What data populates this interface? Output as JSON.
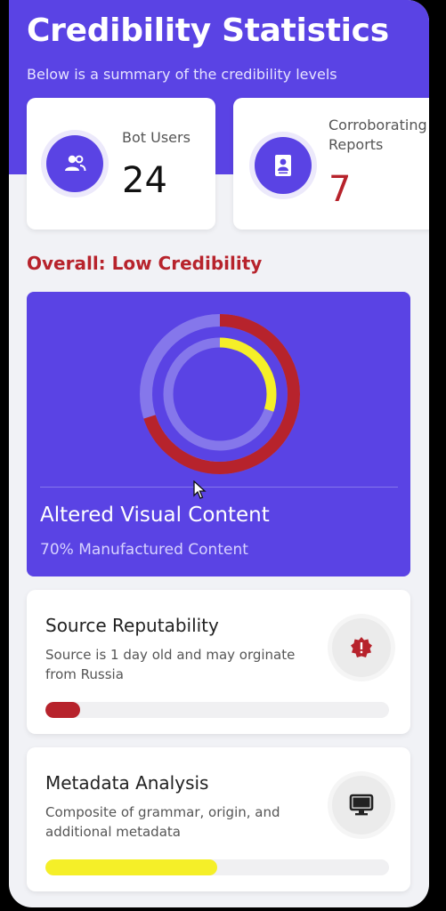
{
  "header": {
    "title": "Credibility Statistics",
    "subtitle": "Below is a summary of the credibility levels"
  },
  "stats": [
    {
      "label": "Bot Users",
      "value": "24",
      "icon": "users-icon"
    },
    {
      "label": "Corroborating Reports",
      "value": "7",
      "icon": "report-icon"
    }
  ],
  "overall": {
    "text": "Overall: Low Credibility"
  },
  "visual": {
    "title": "Altered Visual Content",
    "subtitle": "70% Manufactured Content",
    "outer_ring_fraction": 0.7,
    "inner_ring_fraction": 0.3
  },
  "metrics": [
    {
      "title": "Source Reputability",
      "description": "Source is 1 day old and may orginate from Russia",
      "icon": "alert-badge-icon",
      "progress": 0.1,
      "color": "#b7232c"
    },
    {
      "title": "Metadata Analysis",
      "description": "Composite of grammar, origin, and additional metadata",
      "icon": "monitor-icon",
      "progress": 0.5,
      "color": "#f5ef28"
    }
  ],
  "colors": {
    "primary": "#5a43e4",
    "danger": "#b7232c",
    "warning": "#f5ef28",
    "ring_track": "#8577eb"
  }
}
